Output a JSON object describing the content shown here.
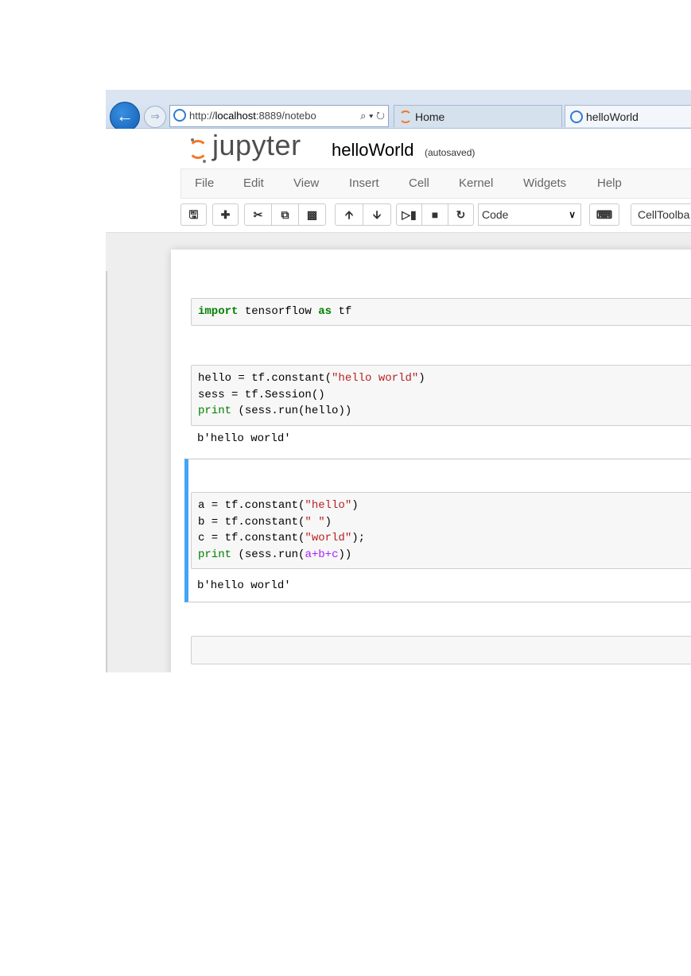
{
  "browser": {
    "address": {
      "scheme": "http://",
      "host": "localhost",
      "rest": ":8889/notebo",
      "tools": "⌕ ▾ ↻"
    },
    "tabs": [
      {
        "label": "Home"
      },
      {
        "label": "helloWorld"
      }
    ]
  },
  "header": {
    "logo_text": "jupyter",
    "notebook_name": "helloWorld",
    "autosave_status": "(autosaved)"
  },
  "menu": [
    {
      "label": "File"
    },
    {
      "label": "Edit"
    },
    {
      "label": "View"
    },
    {
      "label": "Insert"
    },
    {
      "label": "Cell"
    },
    {
      "label": "Kernel"
    },
    {
      "label": "Widgets"
    },
    {
      "label": "Help"
    }
  ],
  "toolbar": {
    "cell_type": "Code",
    "cell_toolbar": "CellToolba"
  },
  "cells": [
    {
      "lines": [
        [
          {
            "t": "import",
            "c": "kw"
          },
          {
            "t": " tensorflow ",
            "c": ""
          },
          {
            "t": "as",
            "c": "kw"
          },
          {
            "t": " tf",
            "c": ""
          }
        ]
      ],
      "output": ""
    },
    {
      "lines": [
        [
          {
            "t": "hello = tf.constant(",
            "c": ""
          },
          {
            "t": "\"hello world\"",
            "c": "str"
          },
          {
            "t": ")",
            "c": ""
          }
        ],
        [
          {
            "t": "sess = tf.Session()",
            "c": ""
          }
        ],
        [
          {
            "t": "print",
            "c": "bi"
          },
          {
            "t": " (sess.run(hello))",
            "c": ""
          }
        ]
      ],
      "output": "b'hello world'"
    },
    {
      "lines": [
        [
          {
            "t": "a = tf.constant(",
            "c": ""
          },
          {
            "t": "\"hello\"",
            "c": "str"
          },
          {
            "t": ")",
            "c": ""
          }
        ],
        [
          {
            "t": "b = tf.constant(",
            "c": ""
          },
          {
            "t": "\" \"",
            "c": "str"
          },
          {
            "t": ")",
            "c": ""
          }
        ],
        [
          {
            "t": "c = tf.constant(",
            "c": ""
          },
          {
            "t": "\"world\"",
            "c": "str"
          },
          {
            "t": ");",
            "c": ""
          }
        ],
        [
          {
            "t": "print",
            "c": "bi"
          },
          {
            "t": " (sess.run(",
            "c": ""
          },
          {
            "t": "a",
            "c": "op"
          },
          {
            "t": "+",
            "c": "op"
          },
          {
            "t": "b",
            "c": "op"
          },
          {
            "t": "+",
            "c": "op"
          },
          {
            "t": "c",
            "c": "op"
          },
          {
            "t": "))",
            "c": ""
          }
        ]
      ],
      "output": "b'hello world'"
    },
    {
      "lines": [],
      "output": ""
    }
  ],
  "colors": {
    "accent_selected": "#42a5f5",
    "jupyter_orange": "#f37726",
    "keyword": "#008000",
    "string": "#ba2121",
    "operator": "#aa22ff"
  }
}
